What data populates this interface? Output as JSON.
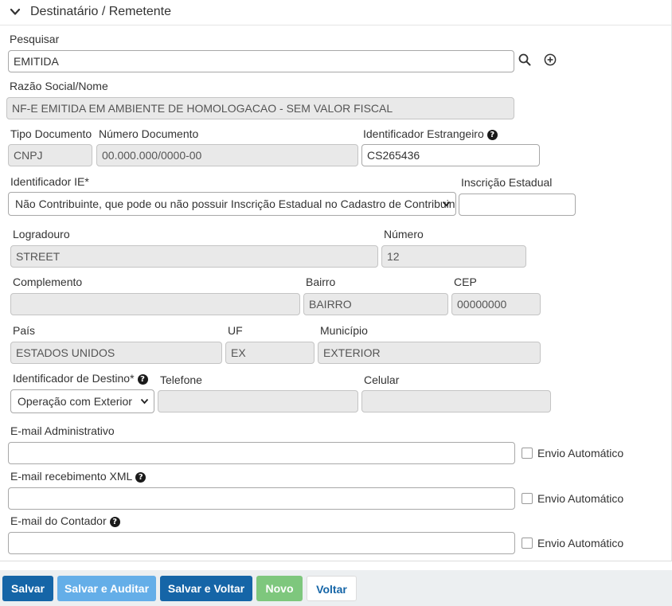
{
  "section": {
    "title": "Destinatário / Remetente"
  },
  "search": {
    "label": "Pesquisar",
    "value": "EMITIDA"
  },
  "razao_social": {
    "label": "Razão Social/Nome",
    "value": "NF-E EMITIDA EM AMBIENTE DE HOMOLOGACAO - SEM VALOR FISCAL"
  },
  "tipo_documento": {
    "label": "Tipo Documento",
    "value": "CNPJ"
  },
  "numero_documento": {
    "label": "Número Documento",
    "value": "00.000.000/0000-00"
  },
  "identificador_estrangeiro": {
    "label": "Identificador Estrangeiro",
    "value": "CS265436"
  },
  "identificador_ie": {
    "label": "Identificador IE*",
    "selected": "Não Contribuinte, que pode ou não possuir Inscrição Estadual no Cadastro de Contribuintes do ICMS"
  },
  "inscricao_estadual": {
    "label": "Inscrição Estadual",
    "value": ""
  },
  "logradouro": {
    "label": "Logradouro",
    "value": "STREET"
  },
  "numero": {
    "label": "Número",
    "value": "12"
  },
  "complemento": {
    "label": "Complemento",
    "value": ""
  },
  "bairro": {
    "label": "Bairro",
    "value": "BAIRRO"
  },
  "cep": {
    "label": "CEP",
    "value": "00000000"
  },
  "pais": {
    "label": "País",
    "value": "ESTADOS UNIDOS"
  },
  "uf": {
    "label": "UF",
    "value": "EX"
  },
  "municipio": {
    "label": "Município",
    "value": "EXTERIOR"
  },
  "identificador_destino": {
    "label": "Identificador de Destino*",
    "selected": "Operação com Exterior"
  },
  "telefone": {
    "label": "Telefone",
    "value": ""
  },
  "celular": {
    "label": "Celular",
    "value": ""
  },
  "email_admin": {
    "label": "E-mail Administrativo",
    "value": "",
    "auto_label": "Envio Automático"
  },
  "email_xml": {
    "label": "E-mail recebimento XML",
    "value": "",
    "auto_label": "Envio Automático"
  },
  "email_contador": {
    "label": "E-mail do Contador",
    "value": "",
    "auto_label": "Envio Automático"
  },
  "footer": {
    "salvar": "Salvar",
    "salvar_auditar": "Salvar e Auditar",
    "salvar_voltar": "Salvar e Voltar",
    "novo": "Novo",
    "voltar": "Voltar"
  },
  "colors": {
    "primary": "#1565a7",
    "primary_light": "#64aee8",
    "success_light": "#7ec77d",
    "readonly_bg": "#e9e9e9",
    "footer_bg": "#eceff1"
  },
  "icons": [
    "chevron-down-icon",
    "search-icon",
    "add-circle-icon",
    "help-icon",
    "select-arrow-icon"
  ]
}
